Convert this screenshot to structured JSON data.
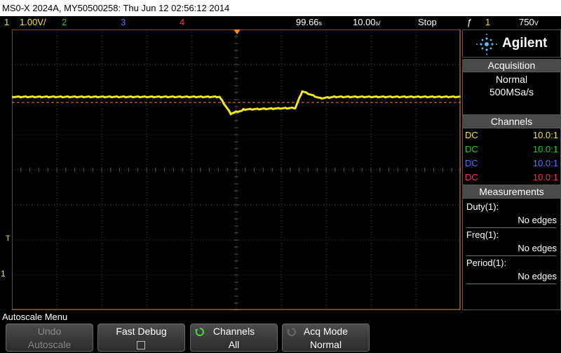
{
  "title_bar": {
    "text": "MS0-X 2024A, MY50500258: Thu Jun 12 02:56:12 2014"
  },
  "status": {
    "ch1_num": "1",
    "ch1_scale": "1.00V/",
    "ch2_num": "2",
    "ch3_num": "3",
    "ch4_num": "4",
    "time_pos": "99.66",
    "time_pos_unit": "s",
    "timebase": "10.00",
    "timebase_unit": "s/",
    "run_state": "Stop",
    "trigger_icon": "edge-trigger-icon",
    "trigger_src": "1",
    "trigger_level": "750",
    "trigger_unit": "V"
  },
  "colors": {
    "ch1": "#f0e818",
    "ch2": "#18d018",
    "ch3": "#5a6cff",
    "ch4": "#ff2a6a",
    "trigger_marker": "#ff8a00",
    "panel_header": "#4a4a4a"
  },
  "sidebar": {
    "brand": "Agilent",
    "acquisition": {
      "header": "Acquisition",
      "mode": "Normal",
      "rate": "500MSa/s"
    },
    "channels": {
      "header": "Channels",
      "rows": [
        {
          "coupling": "DC",
          "probe": "10.0:1"
        },
        {
          "coupling": "DC",
          "probe": "10.0:1"
        },
        {
          "coupling": "DC",
          "probe": "10.0:1"
        },
        {
          "coupling": "DC",
          "probe": "10.0:1"
        }
      ]
    },
    "measurements": {
      "header": "Measurements",
      "items": [
        {
          "label": "Duty(1):",
          "value": "No edges"
        },
        {
          "label": "Freq(1):",
          "value": "No edges"
        },
        {
          "label": "Period(1):",
          "value": "No edges"
        }
      ]
    }
  },
  "graticule": {
    "trigger_level_marker": "T",
    "ch1_ground_marker": "1"
  },
  "softkey_menu": {
    "title": "Autoscale Menu",
    "keys": [
      {
        "line1": "Undo",
        "line2": "Autoscale",
        "enabled": false
      },
      {
        "line1": "Fast Debug",
        "line2": "",
        "enabled": true
      },
      {
        "line1": "Channels",
        "line2": "All",
        "enabled": true
      },
      {
        "line1": "Acq Mode",
        "line2": "Normal",
        "enabled": true
      }
    ]
  }
}
